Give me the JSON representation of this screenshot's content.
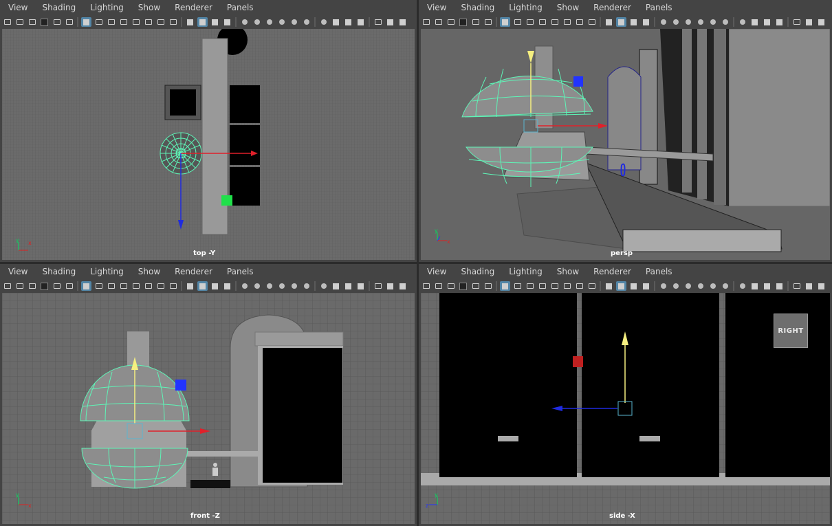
{
  "menu": [
    "View",
    "Shading",
    "Lighting",
    "Show",
    "Renderer",
    "Panels"
  ],
  "panels": {
    "top": {
      "label": "top -Y"
    },
    "persp": {
      "label": "persp"
    },
    "front": {
      "label": "front -Z"
    },
    "side": {
      "label": "side -X"
    }
  },
  "view_cube": {
    "label": "RIGHT"
  },
  "colors": {
    "wireframe": "#5ef5b7",
    "selection": "#5285a6",
    "axis_x": "#e0202a",
    "axis_y": "#f5ef80",
    "axis_z": "#1f2be0",
    "manipulator_blue": "#2233ff"
  },
  "toolbar_icons": [
    "camera-icon",
    "camera-select-icon",
    "camera-attr-icon",
    "bookmark-icon",
    "camera-move-icon",
    "camera-track-icon",
    "paint-icon",
    "grid-icon",
    "film-gate-icon",
    "resolution-gate-icon",
    "gate-mask-icon",
    "field-chart-icon",
    "safe-action-icon",
    "safe-title-icon",
    "wireframe-icon",
    "smooth-shade-icon",
    "wire-on-shaded-icon",
    "textured-icon",
    "lighting-icon",
    "shadows-icon",
    "ambient-occlusion-icon",
    "motion-blur-icon",
    "anti-alias-icon",
    "depth-of-field-icon",
    "isolate-icon",
    "xray-icon",
    "xray-joints-icon",
    "backface-icon",
    "select-icon",
    "panel-layout-icon",
    "panel-layout2-icon"
  ]
}
